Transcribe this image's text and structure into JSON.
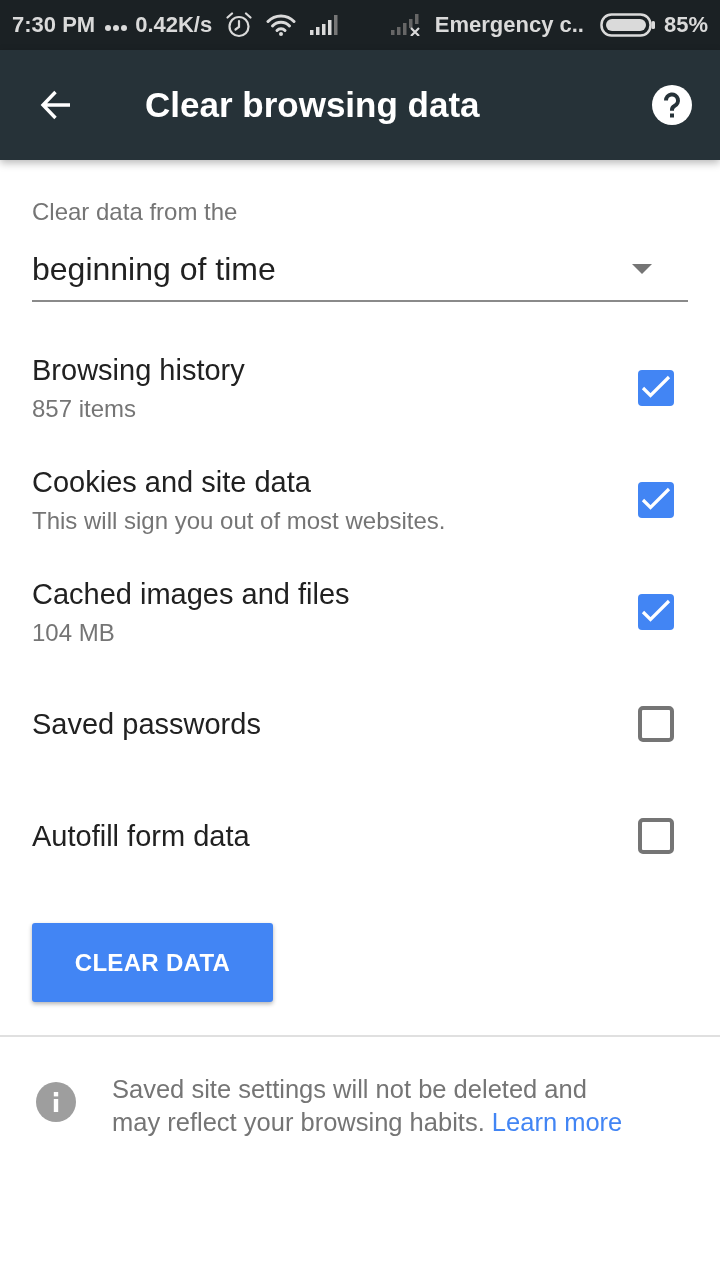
{
  "status_bar": {
    "time": "7:30 PM",
    "speed": "0.42K/s",
    "carrier": "Emergency c..",
    "battery": "85%"
  },
  "app_bar": {
    "title": "Clear browsing data"
  },
  "time_range": {
    "label": "Clear data from the",
    "value": "beginning of time"
  },
  "options": [
    {
      "title": "Browsing history",
      "subtitle": "857 items",
      "checked": true
    },
    {
      "title": "Cookies and site data",
      "subtitle": "This will sign you out of most websites.",
      "checked": true
    },
    {
      "title": "Cached images and files",
      "subtitle": "104 MB",
      "checked": true
    },
    {
      "title": "Saved passwords",
      "checked": false
    },
    {
      "title": "Autofill form data",
      "checked": false
    }
  ],
  "clear_button": {
    "label": "CLEAR DATA"
  },
  "footer": {
    "note": "Saved site settings will not be deleted and may reflect your browsing habits.",
    "link": "Learn more"
  }
}
